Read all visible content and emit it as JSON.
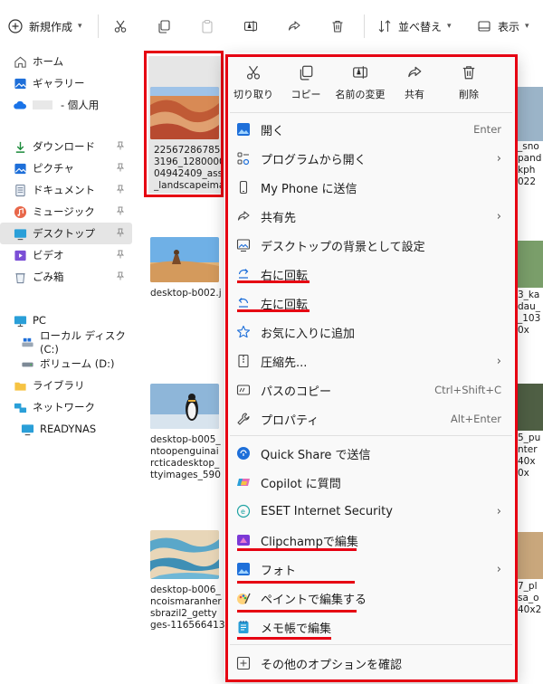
{
  "toolbar": {
    "new_label": "新規作成",
    "sort_label": "並べ替え",
    "view_label": "表示"
  },
  "sidebar": {
    "items": [
      {
        "label": "ホーム",
        "icon": "home-icon"
      },
      {
        "label": "ギャラリー",
        "icon": "gallery-icon"
      },
      {
        "label": "- 個人用",
        "icon": "onedrive-icon"
      },
      {
        "label": "ダウンロード",
        "icon": "download-icon"
      },
      {
        "label": "ピクチャ",
        "icon": "pictures-icon"
      },
      {
        "label": "ドキュメント",
        "icon": "documents-icon"
      },
      {
        "label": "ミュージック",
        "icon": "music-icon"
      },
      {
        "label": "デスクトップ",
        "icon": "desktop-icon"
      },
      {
        "label": "ビデオ",
        "icon": "videos-icon"
      },
      {
        "label": "ごみ箱",
        "icon": "recycle-bin-icon"
      },
      {
        "label": "PC",
        "icon": "pc-icon"
      },
      {
        "label": "ローカル ディスク (C:)",
        "icon": "drive-icon"
      },
      {
        "label": "ボリューム (D:)",
        "icon": "drive-icon"
      },
      {
        "label": "ライブラリ",
        "icon": "library-icon"
      },
      {
        "label": "ネットワーク",
        "icon": "network-icon"
      },
      {
        "label": "READYNAS",
        "icon": "nas-icon"
      }
    ]
  },
  "files": [
    {
      "lines": [
        "225672867858",
        "3196_1280000",
        "04942409_asse",
        "_landscapeima"
      ]
    },
    {
      "lines": [
        "desktop-b002.j"
      ]
    },
    {
      "lines": [
        "desktop-b005_",
        "ntoopenguinai",
        "rcticadesktop_",
        "ttyimages_590"
      ]
    },
    {
      "lines": [
        "desktop-b006_",
        "ncoismaranher",
        "sbrazil2_getty",
        "ges-116566413"
      ]
    }
  ],
  "right_column": [
    {
      "lines": [
        "_sno",
        "pand",
        "kph",
        "022"
      ]
    },
    {
      "lines": [
        "3_ka",
        "dau_",
        "_103",
        "0x"
      ]
    },
    {
      "lines": [
        "5_pu",
        "nter",
        "40x",
        "0x"
      ]
    },
    {
      "lines": [
        "7_pl",
        "sa_o",
        "40x2"
      ]
    }
  ],
  "menu": {
    "quick_actions": [
      {
        "label": "切り取り",
        "icon": "scissors-icon"
      },
      {
        "label": "コピー",
        "icon": "copy-icon"
      },
      {
        "label": "名前の変更",
        "icon": "rename-icon"
      },
      {
        "label": "共有",
        "icon": "share-icon"
      },
      {
        "label": "削除",
        "icon": "trash-icon"
      }
    ],
    "items": [
      {
        "label": "開く",
        "shortcut": "Enter",
        "icon": "photos-icon"
      },
      {
        "label": "プログラムから開く",
        "submenu": true,
        "icon": "open-with-icon"
      },
      {
        "label": "My Phone に送信",
        "icon": "phone-icon"
      },
      {
        "label": "共有先",
        "submenu": true,
        "icon": "share-icon"
      },
      {
        "label": "デスクトップの背景として設定",
        "icon": "wallpaper-icon"
      },
      {
        "label": "右に回転",
        "icon": "rotate-right-icon"
      },
      {
        "label": "左に回転",
        "icon": "rotate-left-icon"
      },
      {
        "label": "お気に入りに追加",
        "icon": "star-icon"
      },
      {
        "label": "圧縮先...",
        "submenu": true,
        "icon": "zip-icon"
      },
      {
        "label": "パスのコピー",
        "shortcut": "Ctrl+Shift+C",
        "icon": "copy-path-icon"
      },
      {
        "label": "プロパティ",
        "shortcut": "Alt+Enter",
        "icon": "wrench-icon"
      },
      {
        "label": "Quick Share で送信",
        "icon": "quick-share-icon"
      },
      {
        "label": "Copilot に質問",
        "icon": "copilot-icon"
      },
      {
        "label": "ESET Internet Security",
        "submenu": true,
        "icon": "eset-icon"
      },
      {
        "label": "Clipchampで編集",
        "icon": "clipchamp-icon"
      },
      {
        "label": "フォト",
        "submenu": true,
        "icon": "photos-icon"
      },
      {
        "label": "ペイントで編集する",
        "icon": "paint-icon"
      },
      {
        "label": "メモ帳で編集",
        "icon": "notepad-icon"
      },
      {
        "label": "その他のオプションを確認",
        "icon": "more-options-icon"
      }
    ]
  },
  "colors": {
    "highlight": "#e60012",
    "accent": "#0067c0",
    "menu_bg": "#f9f9f9",
    "active_bg": "#e5e5e5"
  }
}
